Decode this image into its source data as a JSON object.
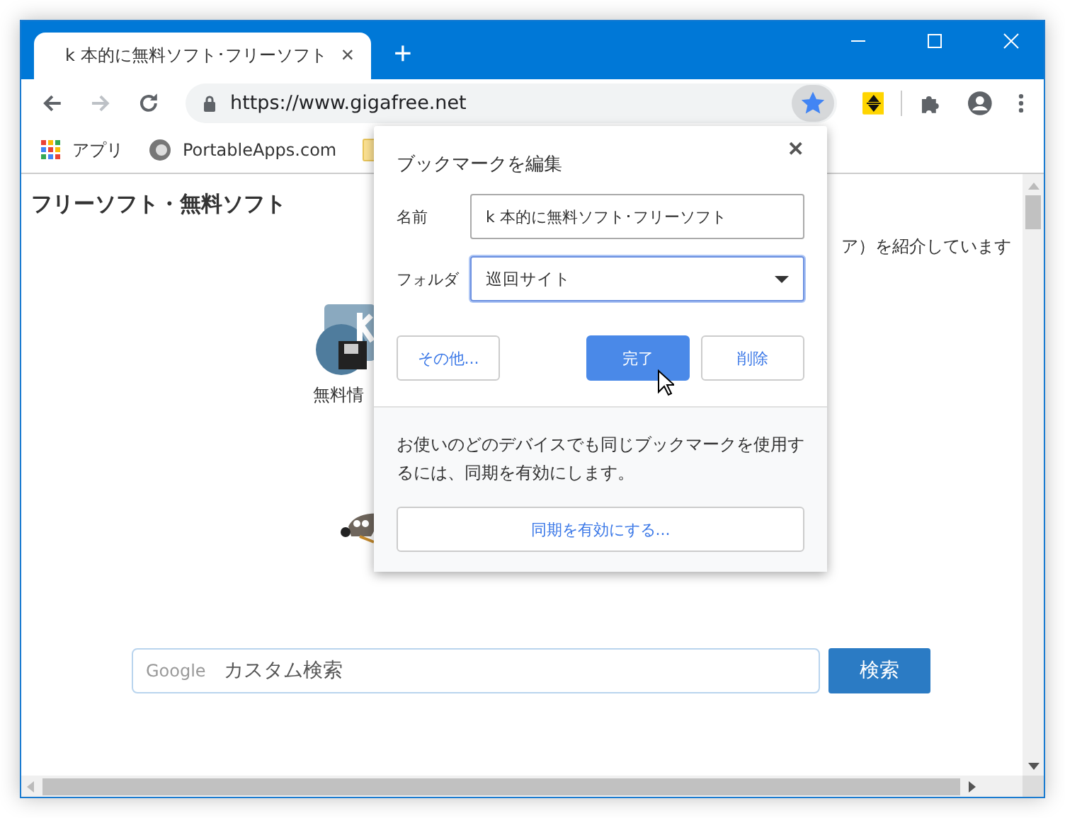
{
  "tabs": [
    {
      "title": "k 本的に無料ソフト･フリーソフト",
      "close": "×",
      "selected": true
    }
  ],
  "new_tab": "+",
  "address_bar": {
    "url": "https://www.gigafree.net",
    "bookmarked": true
  },
  "bookmarks": [
    {
      "kind": "apps",
      "label": "アプリ"
    },
    {
      "kind": "site",
      "label": "PortableApps.com"
    },
    {
      "kind": "folder"
    }
  ],
  "page": {
    "heading": "フリーソフト・無料ソフト",
    "intro_fragment": "ア）を紹介しています",
    "icon_caption": "無料情",
    "search": {
      "logo": "Google",
      "placeholder": "カスタム検索",
      "button": "検索"
    }
  },
  "dialog": {
    "title": "ブックマークを編集",
    "close": "✕",
    "name_label": "名前",
    "name_value": "k 本的に無料ソフト･フリーソフト",
    "folder_label": "フォルダ",
    "folder_value": "巡回サイト",
    "buttons": [
      {
        "label": "その他...",
        "kind": "secondary"
      },
      {
        "label": "完了",
        "kind": "primary"
      },
      {
        "label": "削除",
        "kind": "secondary"
      }
    ],
    "sync_text": "お使いのどのデバイスでも同じブックマークを使用するには、同期を有効にします。",
    "sync_button": "同期を有効にする..."
  }
}
